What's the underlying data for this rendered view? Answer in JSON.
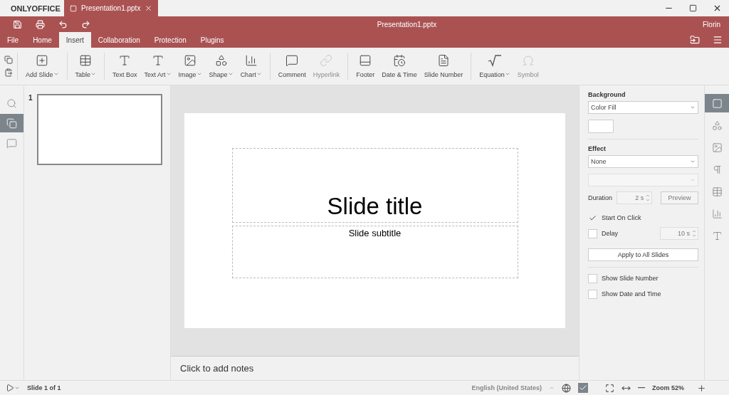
{
  "app": {
    "brand": "ONLYOFFICE"
  },
  "doc_tabs": [
    {
      "label": "Presentation1.pptx",
      "selected": true
    }
  ],
  "header": {
    "title": "Presentation1.pptx",
    "user": "Florin"
  },
  "menu_tabs": [
    {
      "label": "File",
      "selected": false
    },
    {
      "label": "Home",
      "selected": false
    },
    {
      "label": "Insert",
      "selected": true
    },
    {
      "label": "Collaboration",
      "selected": false
    },
    {
      "label": "Protection",
      "selected": false
    },
    {
      "label": "Plugins",
      "selected": false
    }
  ],
  "toolbar": {
    "groups": [
      [
        {
          "label": "Add Slide",
          "kind": "add",
          "dropdown": true,
          "disabled": false
        }
      ],
      [
        {
          "label": "Table",
          "kind": "table",
          "dropdown": true,
          "disabled": false
        }
      ],
      [
        {
          "label": "Text Box",
          "kind": "textbox",
          "dropdown": false,
          "disabled": false
        },
        {
          "label": "Text Art",
          "kind": "textart",
          "dropdown": true,
          "disabled": false
        },
        {
          "label": "Image",
          "kind": "image",
          "dropdown": true,
          "disabled": false
        },
        {
          "label": "Shape",
          "kind": "shape",
          "dropdown": true,
          "disabled": false
        },
        {
          "label": "Chart",
          "kind": "chart",
          "dropdown": true,
          "disabled": false
        }
      ],
      [
        {
          "label": "Comment",
          "kind": "comment",
          "dropdown": false,
          "disabled": false
        },
        {
          "label": "Hyperlink",
          "kind": "link",
          "dropdown": false,
          "disabled": true
        }
      ],
      [
        {
          "label": "Footer",
          "kind": "footer",
          "dropdown": false,
          "disabled": false
        },
        {
          "label": "Date & Time",
          "kind": "datetime",
          "dropdown": false,
          "disabled": false
        },
        {
          "label": "Slide Number",
          "kind": "number",
          "dropdown": false,
          "disabled": false
        }
      ],
      [
        {
          "label": "Equation",
          "kind": "equation",
          "dropdown": true,
          "disabled": false
        },
        {
          "label": "Symbol",
          "kind": "symbol",
          "dropdown": false,
          "disabled": true
        }
      ]
    ]
  },
  "left_rail": [
    {
      "kind": "search",
      "selected": false
    },
    {
      "kind": "slides",
      "selected": true
    },
    {
      "kind": "comment",
      "selected": false
    }
  ],
  "thumbnails": [
    {
      "number": "1",
      "selected": true
    }
  ],
  "slide": {
    "title": "Slide title",
    "subtitle": "Slide subtitle"
  },
  "notes": {
    "placeholder": "Click to add notes"
  },
  "settings": {
    "background": {
      "label": "Background",
      "value": "Color Fill"
    },
    "effect": {
      "label": "Effect",
      "value": "None"
    },
    "effect_type": {
      "disabled": true
    },
    "duration": {
      "label": "Duration",
      "value": "2 s",
      "disabled": true
    },
    "preview": {
      "label": "Preview",
      "disabled": true
    },
    "start_on_click": {
      "label": "Start On Click",
      "checked": true
    },
    "delay": {
      "label": "Delay",
      "checked": false,
      "value": "10 s",
      "disabled": true
    },
    "apply": {
      "label": "Apply to All Slides"
    },
    "show": [
      {
        "label": "Show Slide Number",
        "checked": false
      },
      {
        "label": "Show Date and Time",
        "checked": false
      }
    ]
  },
  "right_rail": [
    {
      "kind": "slide",
      "selected": true
    },
    {
      "kind": "shape",
      "selected": false
    },
    {
      "kind": "image",
      "selected": false
    },
    {
      "kind": "paragraph",
      "selected": false
    },
    {
      "kind": "table",
      "selected": false
    },
    {
      "kind": "chart",
      "selected": false
    },
    {
      "kind": "textart",
      "selected": false
    }
  ],
  "status_bar": {
    "slide_info": "Slide 1 of 1",
    "language": "English (United States)",
    "zoom": "Zoom 52%"
  }
}
